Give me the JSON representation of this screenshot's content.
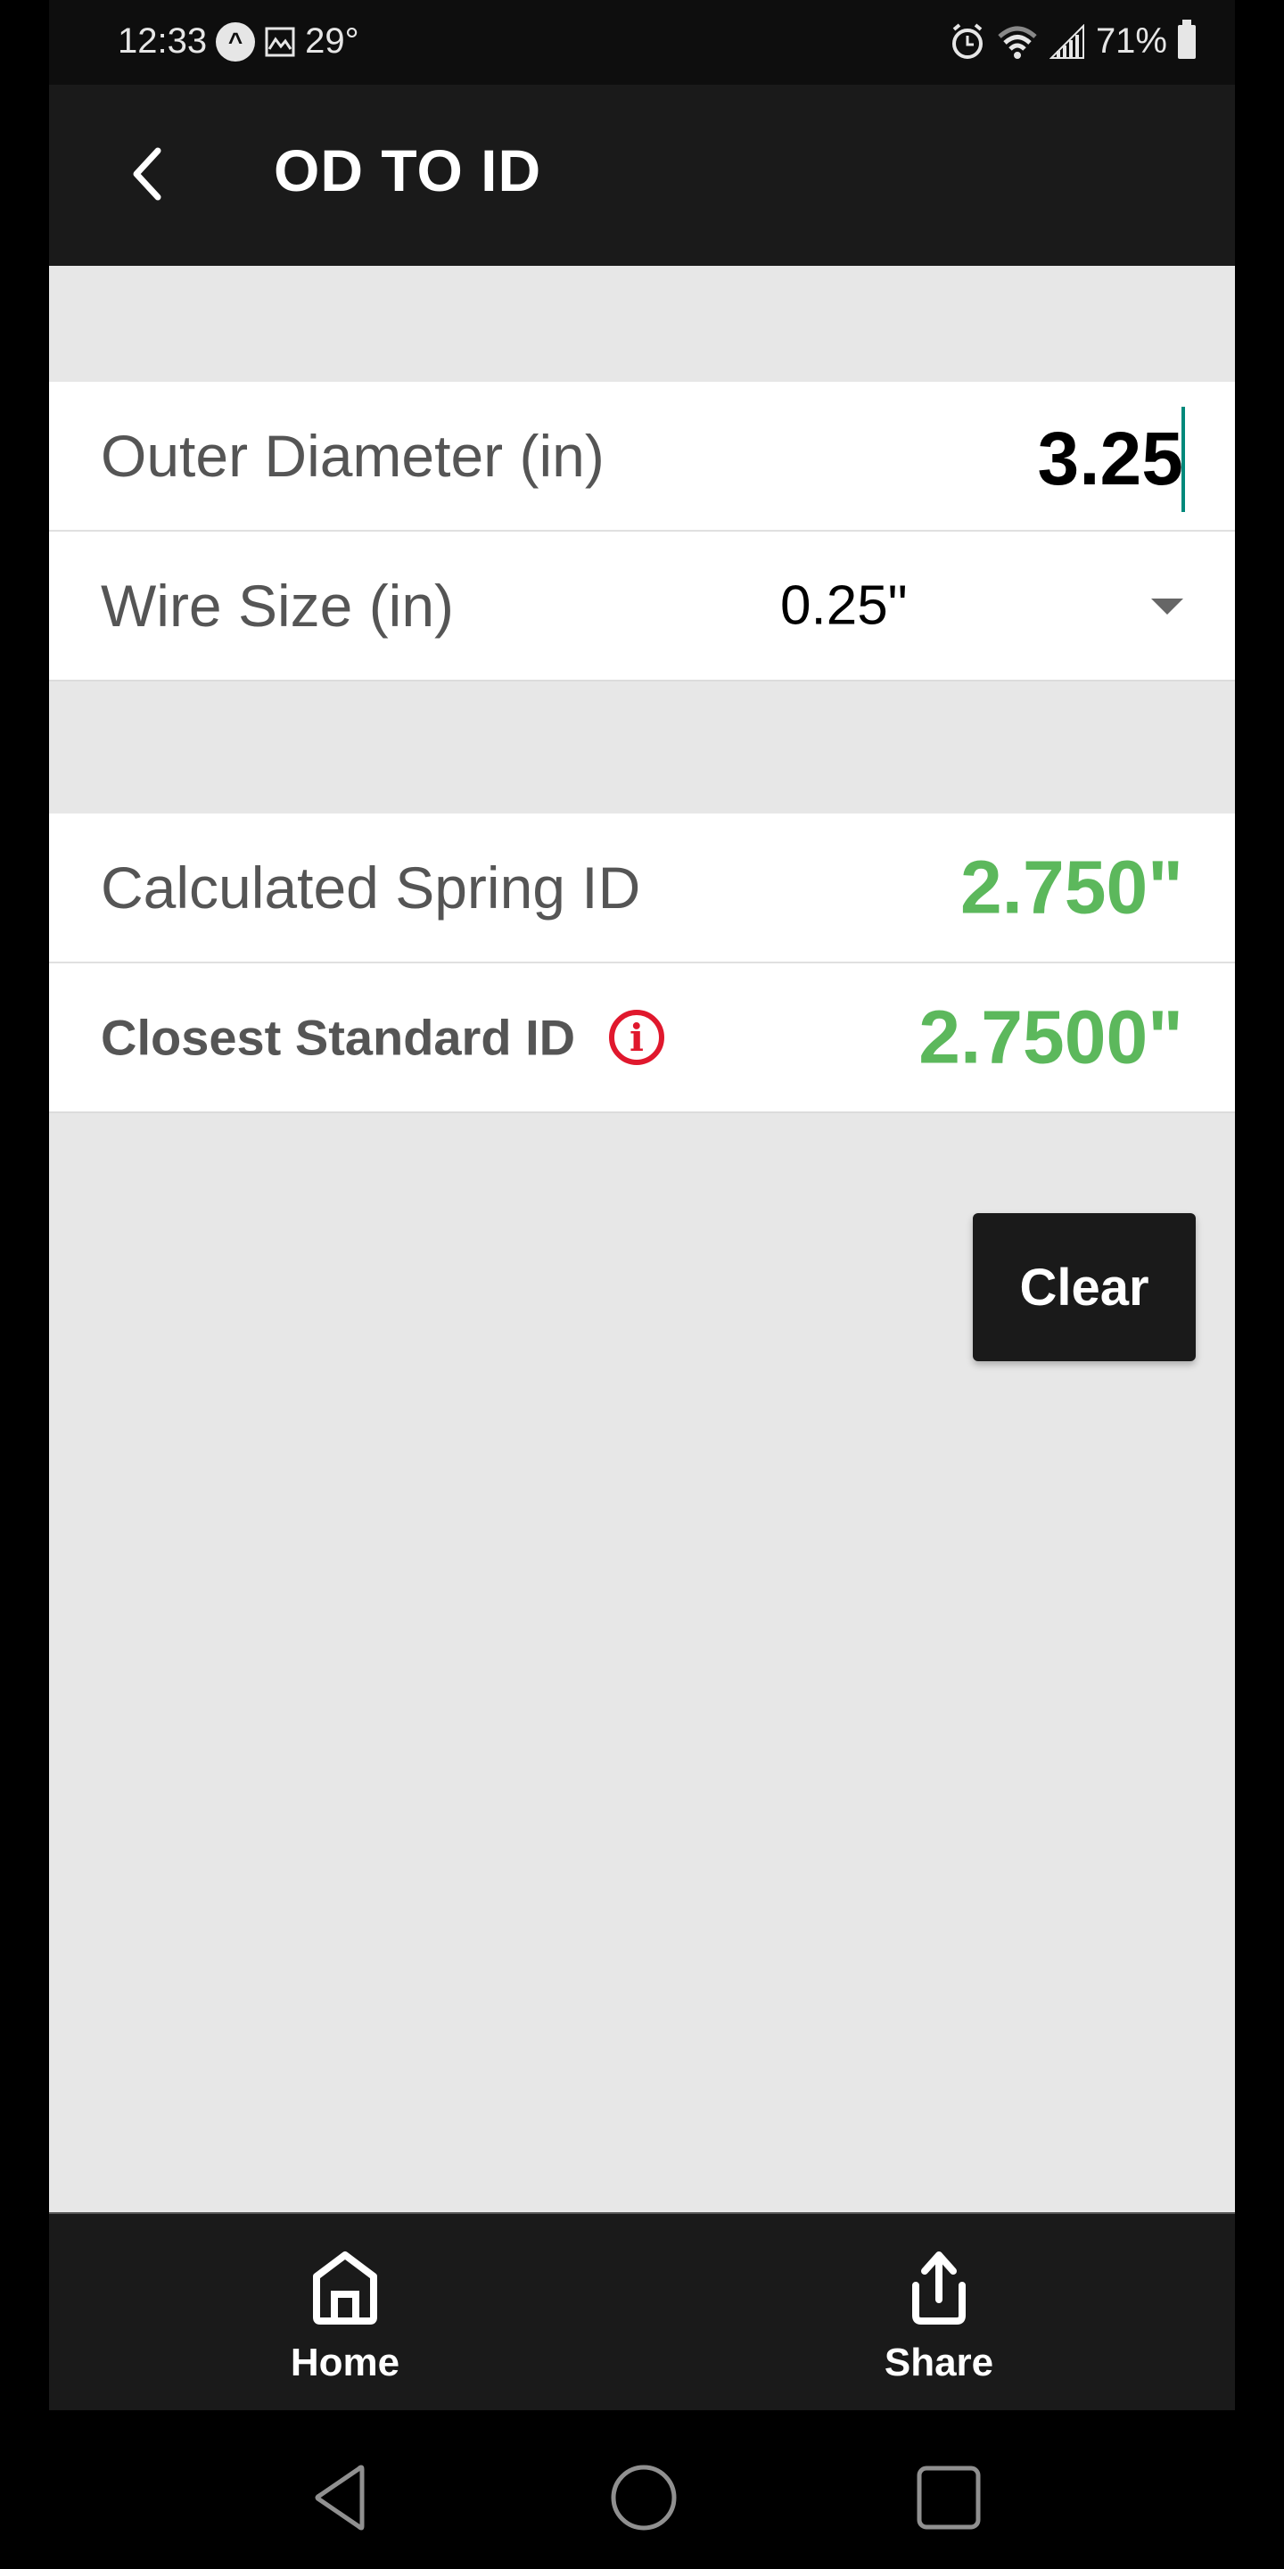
{
  "status_bar": {
    "time": "12:33",
    "temperature": "29°",
    "battery": "71%",
    "icons": [
      "app-notification-icon",
      "gallery-icon",
      "alarm-icon",
      "wifi-icon",
      "signal-icon",
      "battery-icon"
    ]
  },
  "header": {
    "title": "OD TO ID",
    "back_icon": "chevron-left-icon"
  },
  "inputs": {
    "outer_diameter": {
      "label": "Outer Diameter (in)",
      "value": "3.25"
    },
    "wire_size": {
      "label": "Wire Size (in)",
      "selected": "0.25\""
    }
  },
  "results": {
    "calculated_id": {
      "label": "Calculated Spring ID",
      "value": "2.750\""
    },
    "closest_standard_id": {
      "label": "Closest Standard ID",
      "value": "2.7500\"",
      "info_icon": "info-icon"
    }
  },
  "colors": {
    "result_green": "#5cb85c",
    "info_red": "#e0182d",
    "cursor_teal": "#00897b",
    "bar_dark": "#1a1a1a"
  },
  "actions": {
    "clear_label": "Clear"
  },
  "tabbar": {
    "items": [
      {
        "label": "Home",
        "icon": "home-icon"
      },
      {
        "label": "Share",
        "icon": "share-icon"
      }
    ]
  },
  "system_nav": [
    "back-icon",
    "home-circle-icon",
    "recents-icon"
  ]
}
